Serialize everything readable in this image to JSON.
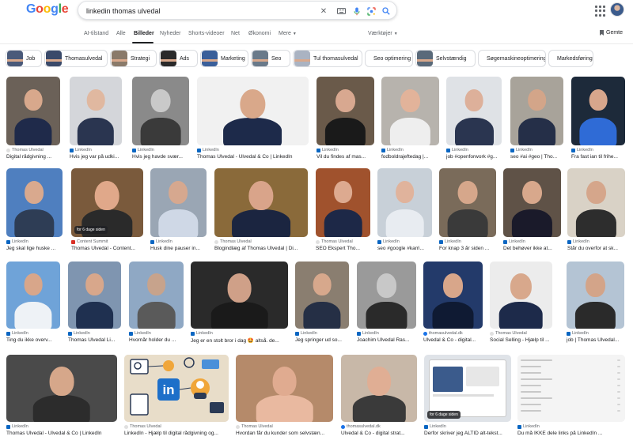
{
  "logo": {
    "letters": [
      "G",
      "o",
      "o",
      "g",
      "l",
      "e"
    ],
    "colors": [
      "#4285f4",
      "#ea4335",
      "#fbbc05",
      "#4285f4",
      "#34a853",
      "#ea4335"
    ]
  },
  "search": {
    "query": "linkedin thomas ulvedal"
  },
  "header": {
    "gemte_label": "Gemte"
  },
  "tabs": [
    {
      "label": "AI-tilstand",
      "active": false
    },
    {
      "label": "Alle",
      "active": false
    },
    {
      "label": "Billeder",
      "active": true
    },
    {
      "label": "Nyheder",
      "active": false
    },
    {
      "label": "Shorts-videoer",
      "active": false
    },
    {
      "label": "Net",
      "active": false
    },
    {
      "label": "Økonomi",
      "active": false
    },
    {
      "label": "Mere",
      "active": false
    }
  ],
  "tools_label": "Værktøjer",
  "chips": [
    {
      "label": "Job",
      "thumb": "#4a5a7a"
    },
    {
      "label": "Thomasulvedal",
      "thumb": "#3a4a6a"
    },
    {
      "label": "Strategi",
      "thumb": "#8a7a6a"
    },
    {
      "label": "Ads",
      "thumb": "#2a2a2a"
    },
    {
      "label": "Marketing",
      "thumb": "#3a5f9a"
    },
    {
      "label": "Seo",
      "thumb": "#6a7a8a"
    },
    {
      "label": "Tul thomasulvedal",
      "thumb": "#aab3c2"
    },
    {
      "label": "Seo optimering",
      "thumb": null
    },
    {
      "label": "Selvstændig",
      "thumb": "#5a6a7a"
    },
    {
      "label": "Søgemaskineoptimering",
      "thumb": null
    },
    {
      "label": "Markedsføring",
      "thumb": null
    }
  ],
  "images": [
    {
      "source": "Thomas Ulvedal",
      "favicon": "gen",
      "caption": "Digital rådgivning ...",
      "bg": "#6b6158",
      "skin": "#d8a88c",
      "shirt": "#1f2a4a"
    },
    {
      "source": "LinkedIn",
      "favicon": "li",
      "caption": "Hvis jeg var på udki...",
      "bg": "#d4d6da",
      "skin": "#e0b8a0",
      "shirt": "#2a3550"
    },
    {
      "source": "LinkedIn",
      "favicon": "li",
      "caption": "Hvis jeg havde svær...",
      "bg": "#8a8a8a",
      "skin": "#c9c9c9",
      "shirt": "#3a3a3a"
    },
    {
      "source": "LinkedIn",
      "favicon": "li",
      "caption": "Thomas Ulvedal - Ulvedal & Co | LinkedIn",
      "bg": "#f1f1f1",
      "skin": "#d9a88a",
      "shirt": "#1d2a4a"
    },
    {
      "source": "LinkedIn",
      "favicon": "li",
      "caption": "Vil du findes af mas...",
      "bg": "#6a5a4a",
      "skin": "#d8a890",
      "shirt": "#1a1a1a"
    },
    {
      "source": "LinkedIn",
      "favicon": "li",
      "caption": "fodboldrajeftedag |...",
      "bg": "#b7b3ad",
      "skin": "#e2b39a",
      "shirt": "#eeeeee"
    },
    {
      "source": "LinkedIn",
      "favicon": "li",
      "caption": "job #openforwork #g...",
      "bg": "#dfe2e6",
      "skin": "#ddb09a",
      "shirt": "#2a3550"
    },
    {
      "source": "LinkedIn",
      "favicon": "li",
      "caption": "seo #ai #geo | Tho...",
      "bg": "#a8a39a",
      "skin": "#d3a589",
      "shirt": "#252f48"
    },
    {
      "source": "LinkedIn",
      "favicon": "li",
      "caption": "Fra fast ian til frihe...",
      "bg": "#1d2a3a",
      "skin": "#d7a68c",
      "shirt": "#2f6bd6"
    },
    {
      "source": "LinkedIn",
      "favicon": "li",
      "caption": "Jeg skal lige huske ...",
      "bg": "#4f7fbf",
      "skin": "#d9a98e",
      "shirt": "#2e3d55"
    },
    {
      "source": "Content Summit",
      "favicon": "cs",
      "caption": "Thomas Ulvedal - Content...",
      "bg": "#7a5a3c",
      "skin": "#e0a88a",
      "shirt": "#2a2a2a",
      "badge": "for 6 dage siden"
    },
    {
      "source": "LinkedIn",
      "favicon": "li",
      "caption": "Husk dine pauser in...",
      "bg": "#9aa6b4",
      "skin": "#d6a88f",
      "shirt": "#cfd8e6"
    },
    {
      "source": "Thomas Ulvedal",
      "favicon": "gen",
      "caption": "Blogindlæg af Thomas Ulvedal | Di...",
      "bg": "#8a6a3a",
      "skin": "#d9a48a",
      "shirt": "#1b2540"
    },
    {
      "source": "Thomas Ulvedal",
      "favicon": "gen",
      "caption": "SEO Ekspert Tho...",
      "bg": "#a0522d",
      "skin": "#ddaa90",
      "shirt": "#1d2847"
    },
    {
      "source": "LinkedIn",
      "favicon": "li",
      "caption": "seo #google #karri...",
      "bg": "#c8d0d8",
      "skin": "#e0b39c",
      "shirt": "#e8ecf1"
    },
    {
      "source": "LinkedIn",
      "favicon": "li",
      "caption": "For knap 3 år siden ...",
      "bg": "#7a6b5a",
      "skin": "#d6a78b",
      "shirt": "#3a3a3a"
    },
    {
      "source": "LinkedIn",
      "favicon": "li",
      "caption": "Det behøver ikke at...",
      "bg": "#5f5247",
      "skin": "#d8a88c",
      "shirt": "#1a1a2a"
    },
    {
      "source": "LinkedIn",
      "favicon": "li",
      "caption": "Står du overfor at sk...",
      "bg": "#d9d2c6",
      "skin": "#d5a68b",
      "shirt": "#2d2d2d"
    },
    {
      "source": "LinkedIn",
      "favicon": "li",
      "caption": "Ting du ikke overv...",
      "bg": "#6fa3d8",
      "skin": "#d8a68a",
      "shirt": "#eef2f6"
    },
    {
      "source": "LinkedIn",
      "favicon": "li",
      "caption": "Thomas Ulvedal Li...",
      "bg": "#7f95b0",
      "skin": "#d8a78b",
      "shirt": "#1f3050"
    },
    {
      "source": "LinkedIn",
      "favicon": "li",
      "caption": "Hvornår holder du ...",
      "bg": "#8fa8c4",
      "skin": "#c7a38c",
      "shirt": "#5a5a5a"
    },
    {
      "source": "LinkedIn",
      "favicon": "li",
      "caption": "Jeg er en stolt bror i dag 🤩 altså. de...",
      "bg": "#2a2a2a",
      "skin": "#cfa088",
      "shirt": "#1a1a1a"
    },
    {
      "source": "LinkedIn",
      "favicon": "li",
      "caption": "Jeg springer ud so...",
      "bg": "#8a7e70",
      "skin": "#d7a88c",
      "shirt": "#252f45"
    },
    {
      "source": "LinkedIn",
      "favicon": "li",
      "caption": "Joachim Ulvedal Ras...",
      "bg": "#9a9a9a",
      "skin": "#c8c8c8",
      "shirt": "#2a2a2a"
    },
    {
      "source": "thomasulvedal.dk",
      "favicon": "tu",
      "caption": "Ulvedal & Co - digital...",
      "bg": "#233a6a",
      "skin": "#d8a68a",
      "shirt": "#0f1a33"
    },
    {
      "source": "Thomas Ulvedal",
      "favicon": "gen",
      "caption": "Social Selling - Hjælp til ...",
      "bg": "#ececec",
      "skin": "#d8a88c",
      "shirt": "#1d2a4a"
    },
    {
      "source": "LinkedIn",
      "favicon": "li",
      "caption": "job | Thomas Ulvedal...",
      "bg": "#b4c4d4",
      "skin": "#d3a489",
      "shirt": "#2a2a2a"
    },
    {
      "source": "LinkedIn",
      "favicon": "li",
      "caption": "Thomas Ulvedal - Ulvedal & Co | LinkedIn",
      "bg": "#4a4a4a",
      "skin": "#d6a78a",
      "shirt": "#2c2c2c"
    },
    {
      "source": "Thomas Ulvedal",
      "favicon": "gen",
      "caption": "LinkedIn - Hjælp til digital rådgivning og...",
      "bg": "#e8ddc9",
      "special": "icons"
    },
    {
      "source": "Thomas Ulvedal",
      "favicon": "gen",
      "caption": "Hvordan får du kunder som selvstæn...",
      "bg": "#b58a6a",
      "skin": "#e0ab90",
      "shirt": "#e9b9a0"
    },
    {
      "source": "thomasulvedal.dk",
      "favicon": "tu",
      "caption": "Ulvedal & Co - digital strat...",
      "bg": "#c8b8a8",
      "skin": "#e0ae94",
      "shirt": "#3a3a3a"
    },
    {
      "source": "LinkedIn",
      "favicon": "li",
      "caption": "Derfor skriver jeg ALTID alt-tekst...",
      "bg": "#dfe3e8",
      "special": "screen",
      "badge": "for 6 dage siden"
    },
    {
      "source": "LinkedIn",
      "favicon": "li",
      "caption": "Du må IKKE dele links på LinkedIn ...",
      "bg": "#f4f4f4",
      "special": "doc"
    }
  ]
}
